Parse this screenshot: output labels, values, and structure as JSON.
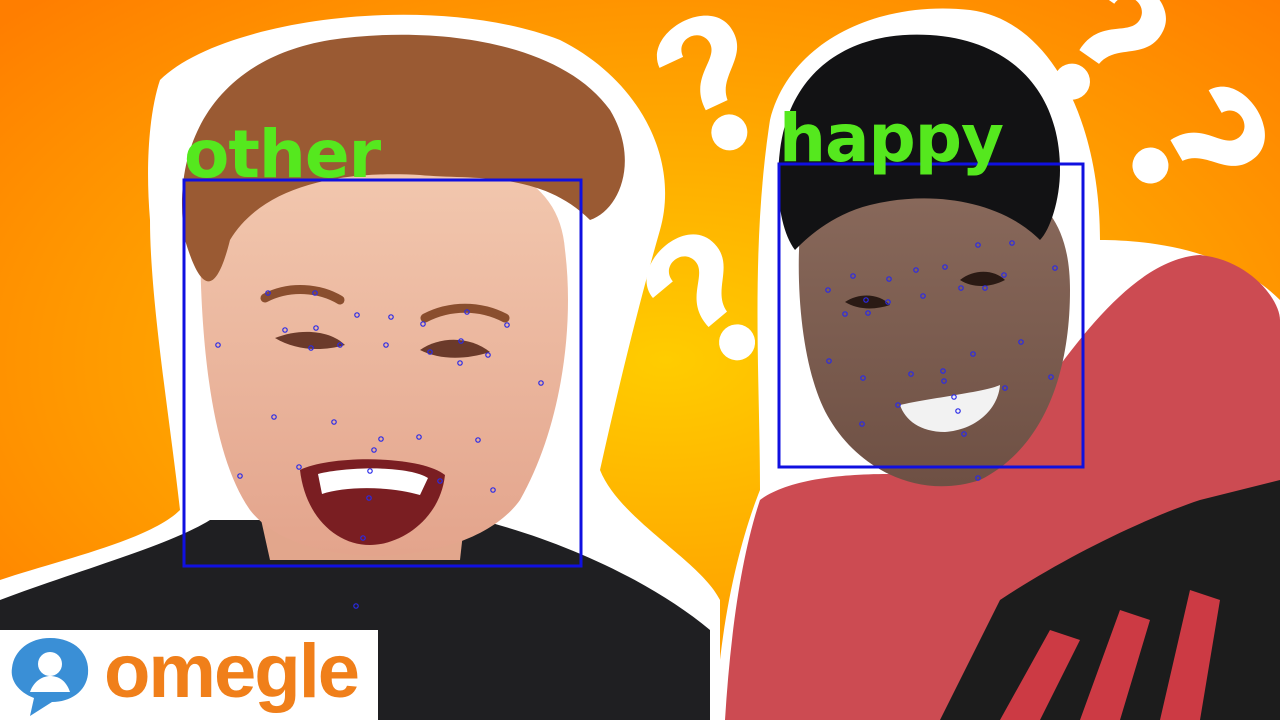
{
  "scene": {
    "subject": "two laughing faces pasted on an orange background",
    "colors": {
      "background_center": "#ffcc00",
      "background_edge": "#ff7e00",
      "sticker_outline": "#ffffff",
      "question_marks": "#ffffff",
      "detection_box": "#1010e0",
      "landmark_dots": "#2a2ae8",
      "label_text": "#55e81e"
    }
  },
  "detections": [
    {
      "label": "other"
    },
    {
      "label": "happy"
    }
  ],
  "logo": {
    "text": "omegle",
    "icon": "speech-bubble-figure-icon",
    "text_color": "#f07f1a",
    "icon_color": "#3a8fd6"
  }
}
